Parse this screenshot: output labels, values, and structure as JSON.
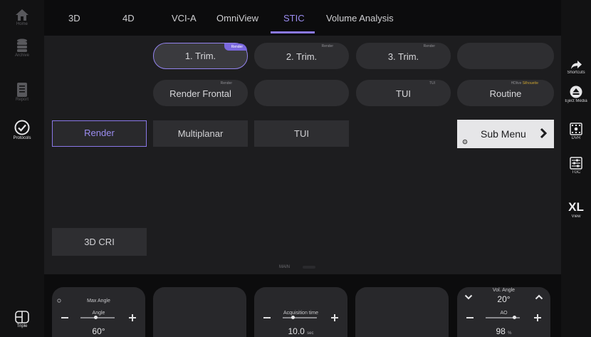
{
  "sidebar_left": {
    "items": [
      {
        "label": "Home"
      },
      {
        "label": "Archive"
      },
      {
        "label": "Report"
      },
      {
        "label": "Protocols"
      }
    ],
    "bottom": {
      "label": "Triple"
    }
  },
  "sidebar_right": {
    "items": [
      {
        "label": "Shortcuts"
      },
      {
        "label": "Eject Media"
      },
      {
        "label": "DVR"
      },
      {
        "label": "TGC"
      },
      {
        "label": "View",
        "big": "XL"
      }
    ]
  },
  "tabs": [
    {
      "label": "3D"
    },
    {
      "label": "4D"
    },
    {
      "label": "VCI-A"
    },
    {
      "label": "OmniView"
    },
    {
      "label": "STIC",
      "active": true
    },
    {
      "label": "Volume Analysis"
    }
  ],
  "presets": {
    "row1": [
      {
        "label": "1. Trim.",
        "tag": "Render",
        "selected": true
      },
      {
        "label": "2. Trim.",
        "tag": "Render"
      },
      {
        "label": "3. Trim.",
        "tag": "Render"
      },
      {
        "label": ""
      }
    ],
    "row2": [
      {
        "label": "Render Frontal",
        "tag": "Render"
      },
      {
        "label": ""
      },
      {
        "label": "TUI",
        "tag": "TUI"
      },
      {
        "label": "Routine",
        "tag": "HDlive",
        "tag_highlight": "Silhouette"
      }
    ]
  },
  "modes": [
    {
      "label": "Render",
      "selected": true
    },
    {
      "label": "Multiplanar"
    },
    {
      "label": "TUI"
    }
  ],
  "submenu": {
    "label": "Sub Menu"
  },
  "cri_button": {
    "label": "3D CRI"
  },
  "panel_label": "MAIN",
  "knobs": [
    {
      "title": "Max Angle",
      "sub_label": "Angle",
      "value": "60°",
      "slider_fraction": 0.45
    },
    {},
    {
      "sub_label": "Acquisition time",
      "value": "10.0",
      "unit": "sec",
      "slider_fraction": 0.3
    },
    {},
    {
      "title": "Vol. Angle",
      "title_value": "20°",
      "sub_label": "AO",
      "value": "98",
      "unit": "%",
      "slider_fraction": 0.85
    }
  ],
  "colors": {
    "accent": "#8a78e8",
    "background": "#0c0c0d",
    "panel": "#1d1d1f",
    "button": "#2e2e31"
  }
}
